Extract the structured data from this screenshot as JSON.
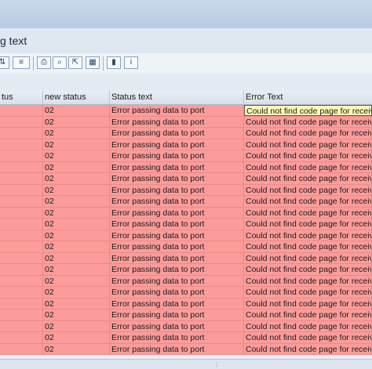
{
  "window": {
    "title": "g text"
  },
  "toolbar": {
    "icons": [
      "filter-icon",
      "sort-icon",
      "print-icon",
      "find-icon",
      "export-icon",
      "grid-icon",
      "chart-icon",
      "info-icon"
    ],
    "glyphs": [
      "⇅",
      "≡",
      "⎙",
      "⌕",
      "⇱",
      "▦",
      "▮",
      "i"
    ]
  },
  "table": {
    "headers": [
      "tus",
      "new status",
      "Status text",
      "Error Text"
    ],
    "rows": [
      {
        "status": "",
        "new_status": "02",
        "status_text": "Error passing data to port",
        "error_text": "Could not find code page for receivin"
      },
      {
        "status": "",
        "new_status": "02",
        "status_text": "Error passing data to port",
        "error_text": "Could not find code page for receivin"
      },
      {
        "status": "",
        "new_status": "02",
        "status_text": "Error passing data to port",
        "error_text": "Could not find code page for receivin"
      },
      {
        "status": "",
        "new_status": "02",
        "status_text": "Error passing data to port",
        "error_text": "Could not find code page for receivin"
      },
      {
        "status": "",
        "new_status": "02",
        "status_text": "Error passing data to port",
        "error_text": "Could not find code page for receivin"
      },
      {
        "status": "",
        "new_status": "02",
        "status_text": "Error passing data to port",
        "error_text": "Could not find code page for receivin"
      },
      {
        "status": "",
        "new_status": "02",
        "status_text": "Error passing data to port",
        "error_text": "Could not find code page for receivin"
      },
      {
        "status": "",
        "new_status": "02",
        "status_text": "Error passing data to port",
        "error_text": "Could not find code page for receivin"
      },
      {
        "status": "",
        "new_status": "02",
        "status_text": "Error passing data to port",
        "error_text": "Could not find code page for receivin"
      },
      {
        "status": "",
        "new_status": "02",
        "status_text": "Error passing data to port",
        "error_text": "Could not find code page for receivin"
      },
      {
        "status": "",
        "new_status": "02",
        "status_text": "Error passing data to port",
        "error_text": "Could not find code page for receivin"
      },
      {
        "status": "",
        "new_status": "02",
        "status_text": "Error passing data to port",
        "error_text": "Could not find code page for receivin"
      },
      {
        "status": "",
        "new_status": "02",
        "status_text": "Error passing data to port",
        "error_text": "Could not find code page for receivin"
      },
      {
        "status": "",
        "new_status": "02",
        "status_text": "Error passing data to port",
        "error_text": "Could not find code page for receivin"
      },
      {
        "status": "",
        "new_status": "02",
        "status_text": "Error passing data to port",
        "error_text": "Could not find code page for receivin"
      },
      {
        "status": "",
        "new_status": "02",
        "status_text": "Error passing data to port",
        "error_text": "Could not find code page for receivin"
      },
      {
        "status": "",
        "new_status": "02",
        "status_text": "Error passing data to port",
        "error_text": "Could not find code page for receivin"
      },
      {
        "status": "",
        "new_status": "02",
        "status_text": "Error passing data to port",
        "error_text": "Could not find code page for receivin"
      },
      {
        "status": "",
        "new_status": "02",
        "status_text": "Error passing data to port",
        "error_text": "Could not find code page for receivin"
      },
      {
        "status": "",
        "new_status": "02",
        "status_text": "Error passing data to port",
        "error_text": "Could not find code page for receivin"
      },
      {
        "status": "",
        "new_status": "02",
        "status_text": "Error passing data to port",
        "error_text": "Could not find code page for receivin"
      },
      {
        "status": "",
        "new_status": "02",
        "status_text": "Error passing data to port",
        "error_text": "Could not find code page for receivin"
      }
    ],
    "row_color": "#fb9c9a",
    "selected_cell_color": "#fff7b8"
  }
}
